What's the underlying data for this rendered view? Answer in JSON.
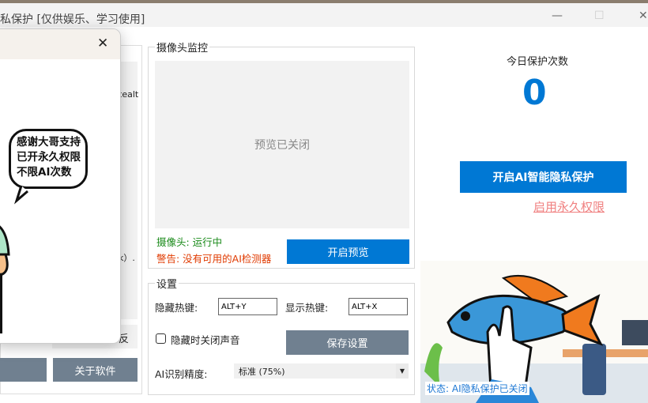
{
  "window": {
    "title": "私保护 [仅供娱乐、学习使用]",
    "minimize": "—",
    "maximize": "☐",
    "close": "✕"
  },
  "left_panel": {
    "fragment1": "tealt",
    "fragment2": "k）.",
    "fragment3": "反",
    "about_button": "关于软件"
  },
  "dialog": {
    "close": "✕",
    "bubble_lines": [
      "感谢大哥支持",
      "已开永久权限",
      "不限AI次数"
    ]
  },
  "camera": {
    "legend": "摄像头监控",
    "preview_text": "预览已关闭",
    "status": "摄像头: 运行中",
    "warning": "警告: 没有可用的AI检测器",
    "preview_button": "开启预览",
    "status_color": "#1a8a1a",
    "warning_color": "#e03a00"
  },
  "settings": {
    "legend": "设置",
    "hide_hotkey_label": "隐藏热键:",
    "hide_hotkey_value": "ALT+Y",
    "show_hotkey_label": "显示热键:",
    "show_hotkey_value": "ALT+X",
    "mute_label": "隐藏时关闭声音",
    "mute_checked": false,
    "save_button": "保存设置",
    "precision_label": "AI识别精度:",
    "precision_value": "标准 (75%)"
  },
  "stats": {
    "label": "今日保护次数",
    "count": "0"
  },
  "actions": {
    "protect_button": "开启AI智能隐私保护",
    "permanent_link": "启用永久权限"
  },
  "status_bar": {
    "text": "状态: AI隐私保护已关闭"
  },
  "colors": {
    "accent": "#0078d4",
    "gray_button": "#708090",
    "link": "#f08080"
  }
}
